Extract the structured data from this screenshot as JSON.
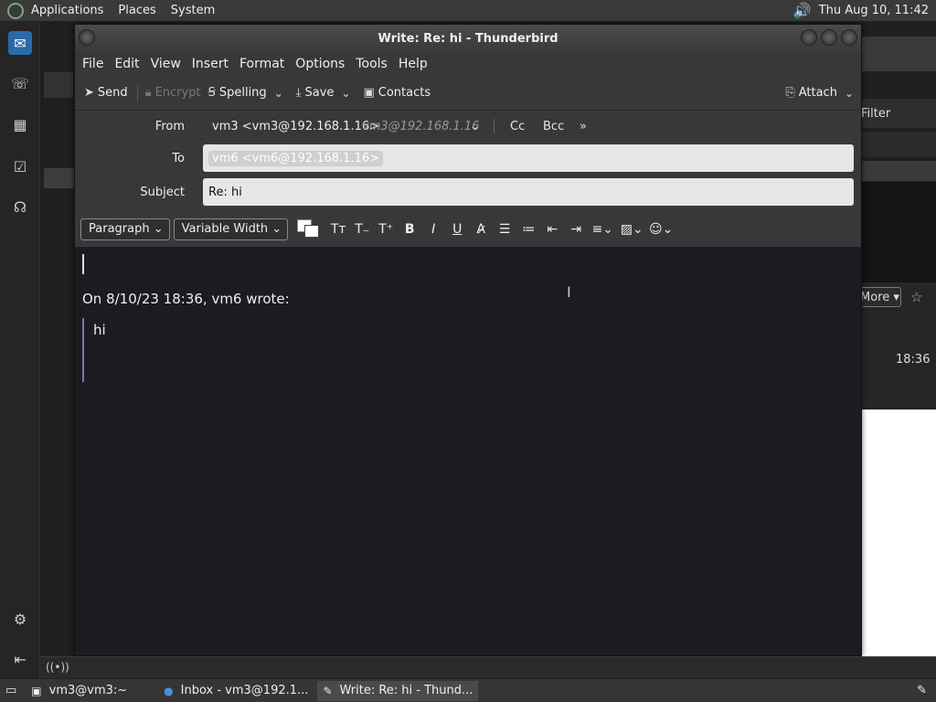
{
  "top_panel": {
    "menus": [
      "Applications",
      "Places",
      "System"
    ],
    "clock": "Thu Aug 10, 11:42"
  },
  "background_window": {
    "filter_label": "Filter",
    "more_label": "More",
    "message_time": "18:36"
  },
  "compose": {
    "title": "Write: Re: hi - Thunderbird",
    "menu": [
      "File",
      "Edit",
      "View",
      "Insert",
      "Format",
      "Options",
      "Tools",
      "Help"
    ],
    "toolbar": {
      "send": "Send",
      "encrypt": "Encrypt",
      "spelling": "Spelling",
      "save": "Save",
      "contacts": "Contacts",
      "attach": "Attach"
    },
    "headers": {
      "from_label": "From",
      "from_value": "vm3 <vm3@192.168.1.16>",
      "from_address": "vm3@192.168.1.16",
      "cc": "Cc",
      "bcc": "Bcc",
      "to_label": "To",
      "to_recipient": "vm6 <vm6@192.168.1.16>",
      "subject_label": "Subject",
      "subject_value": "Re: hi"
    },
    "format": {
      "paragraph": "Paragraph",
      "font": "Variable Width"
    },
    "body": {
      "quote_header": "On 8/10/23 18:36, vm6 wrote:",
      "quoted_text": "hi"
    }
  },
  "taskbar": {
    "tasks": [
      "vm3@vm3:~",
      "Inbox - vm3@192.1...",
      "Write: Re: hi - Thund..."
    ]
  }
}
